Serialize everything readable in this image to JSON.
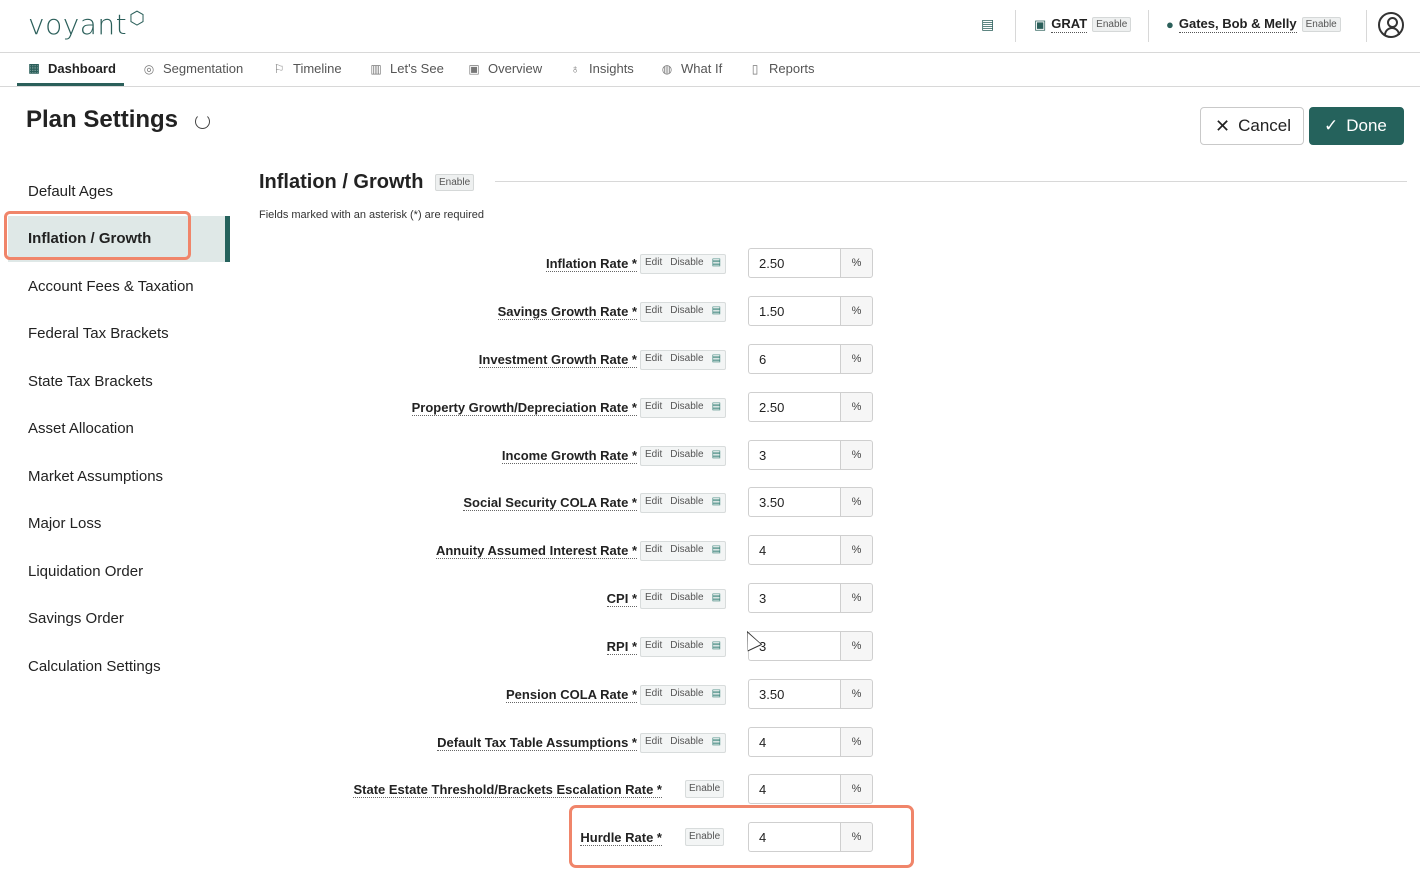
{
  "app": {
    "logo_text": "voyant",
    "header": {
      "grat_label": "GRAT",
      "grat_enable": "Enable",
      "client_label": "Gates, Bob & Melly",
      "client_enable": "Enable"
    }
  },
  "nav": {
    "tabs": [
      {
        "label": "Dashboard",
        "icon": "dashboard-icon"
      },
      {
        "label": "Segmentation",
        "icon": "segmentation-icon"
      },
      {
        "label": "Timeline",
        "icon": "flag-icon"
      },
      {
        "label": "Let's See",
        "icon": "bar-chart-icon"
      },
      {
        "label": "Overview",
        "icon": "document-icon"
      },
      {
        "label": "Insights",
        "icon": "lightbulb-icon"
      },
      {
        "label": "What If",
        "icon": "what-if-icon"
      },
      {
        "label": "Reports",
        "icon": "report-icon"
      }
    ]
  },
  "page": {
    "title": "Plan Settings",
    "cancel_label": "Cancel",
    "done_label": "Done"
  },
  "sidebar": {
    "items": [
      {
        "label": "Default Ages"
      },
      {
        "label": "Inflation / Growth"
      },
      {
        "label": "Account Fees & Taxation"
      },
      {
        "label": "Federal Tax Brackets"
      },
      {
        "label": "State Tax Brackets"
      },
      {
        "label": "Asset Allocation"
      },
      {
        "label": "Market Assumptions"
      },
      {
        "label": "Major Loss"
      },
      {
        "label": "Liquidation Order"
      },
      {
        "label": "Savings Order"
      },
      {
        "label": "Calculation Settings"
      }
    ]
  },
  "section": {
    "title": "Inflation / Growth",
    "enable_label": "Enable",
    "required_note": "Fields marked with an asterisk (*) are required",
    "edit_label": "Edit",
    "disable_label": "Disable",
    "unit": "%",
    "fields": [
      {
        "label": "Inflation Rate *",
        "value": "2.50"
      },
      {
        "label": "Savings Growth Rate *",
        "value": "1.50"
      },
      {
        "label": "Investment Growth Rate *",
        "value": "6"
      },
      {
        "label": "Property Growth/Depreciation Rate *",
        "value": "2.50"
      },
      {
        "label": "Income Growth Rate *",
        "value": "3"
      },
      {
        "label": "Social Security COLA Rate *",
        "value": "3.50"
      },
      {
        "label": "Annuity Assumed Interest Rate *",
        "value": "4"
      },
      {
        "label": "CPI *",
        "value": "3"
      },
      {
        "label": "RPI *",
        "value": "3"
      },
      {
        "label": "Pension COLA Rate *",
        "value": "3.50"
      },
      {
        "label": "Default Tax Table Assumptions *",
        "value": "4"
      },
      {
        "label": "State Estate Threshold/Brackets Escalation Rate *",
        "value": "4"
      },
      {
        "label": "Hurdle Rate *",
        "value": "4"
      }
    ]
  }
}
